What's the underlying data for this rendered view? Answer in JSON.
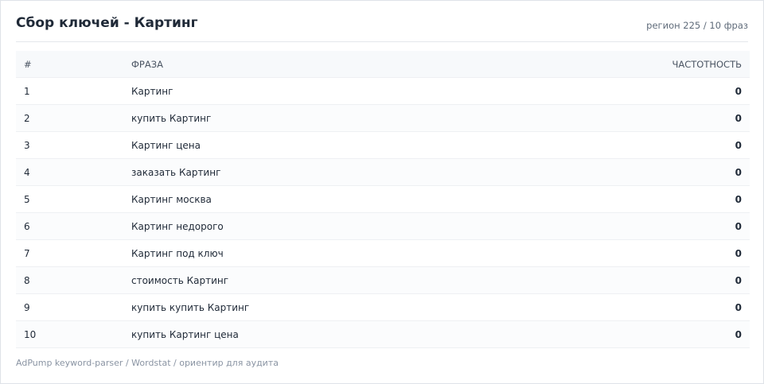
{
  "header": {
    "title": "Сбор ключей - Картинг",
    "meta": "регион 225 / 10 фраз"
  },
  "table": {
    "columns": [
      "#",
      "ФРАЗА",
      "ЧАСТОТНОСТЬ"
    ],
    "rows": [
      {
        "num": "1",
        "phrase": "Картинг",
        "freq": "0"
      },
      {
        "num": "2",
        "phrase": "купить Картинг",
        "freq": "0"
      },
      {
        "num": "3",
        "phrase": "Картинг цена",
        "freq": "0"
      },
      {
        "num": "4",
        "phrase": "заказать Картинг",
        "freq": "0"
      },
      {
        "num": "5",
        "phrase": "Картинг москва",
        "freq": "0"
      },
      {
        "num": "6",
        "phrase": "Картинг недорого",
        "freq": "0"
      },
      {
        "num": "7",
        "phrase": "Картинг под ключ",
        "freq": "0"
      },
      {
        "num": "8",
        "phrase": "стоимость Картинг",
        "freq": "0"
      },
      {
        "num": "9",
        "phrase": "купить купить Картинг",
        "freq": "0"
      },
      {
        "num": "10",
        "phrase": "купить Картинг цена",
        "freq": "0"
      }
    ]
  },
  "footer": {
    "text": "AdPump keyword-parser / Wordstat / ориентир для аудита"
  }
}
